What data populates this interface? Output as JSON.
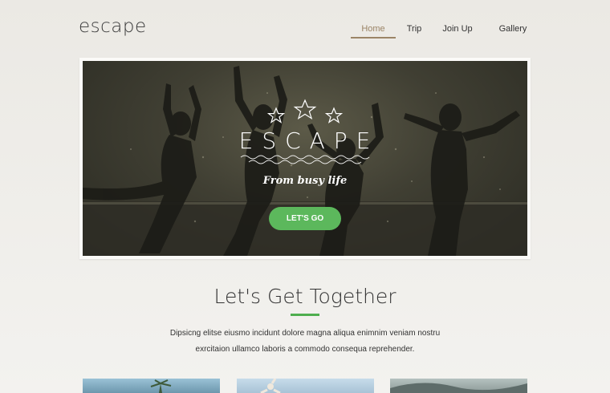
{
  "header": {
    "logo": "escape",
    "nav": [
      {
        "label": "Home",
        "active": true
      },
      {
        "label": "Trip",
        "active": false
      },
      {
        "label": "Join Up",
        "active": false
      },
      {
        "label": "Gallery",
        "active": false
      }
    ]
  },
  "hero": {
    "title": "ESCAPE",
    "subtitle": "From busy life",
    "cta_label": "LET'S GO",
    "image": "silhouettes-jumping-splash-photo",
    "icons": [
      "star-icon",
      "star-icon",
      "star-icon",
      "wave-icon"
    ]
  },
  "intro": {
    "heading": "Let's Get Together",
    "text_line1": "Dipsicng elitse eiusmo incidunt dolore magna aliqua enimnim veniam nostru",
    "text_line2": "exrcitaion ullamco laboris a commodo consequa reprehender."
  },
  "gallery_thumbs": [
    "palm-beach-photo",
    "sky-jump-photo",
    "wave-photo"
  ],
  "colors": {
    "accent": "#5cb85c",
    "nav_active": "#9b8466",
    "background": "#efede9"
  }
}
